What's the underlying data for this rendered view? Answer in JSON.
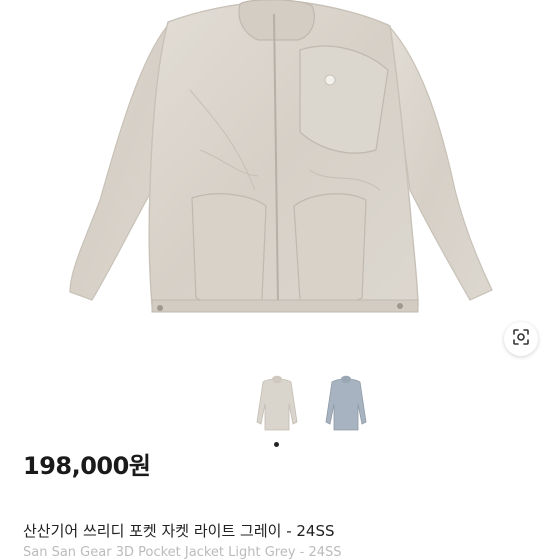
{
  "product": {
    "price": "198,000원",
    "title": "산산기어 쓰리디 포켓 자켓 라이트 그레이 - 24SS",
    "subtitle": "San San Gear 3D Pocket Jacket Light Grey - 24SS"
  },
  "gallery": {
    "image_count": 2,
    "active_index": 0,
    "thumbnails": [
      {
        "color": "#d9d4cc",
        "name": "light-grey"
      },
      {
        "color": "#a7b3c0",
        "name": "blue-grey"
      }
    ]
  },
  "icons": {
    "lens": "image-search-icon"
  }
}
